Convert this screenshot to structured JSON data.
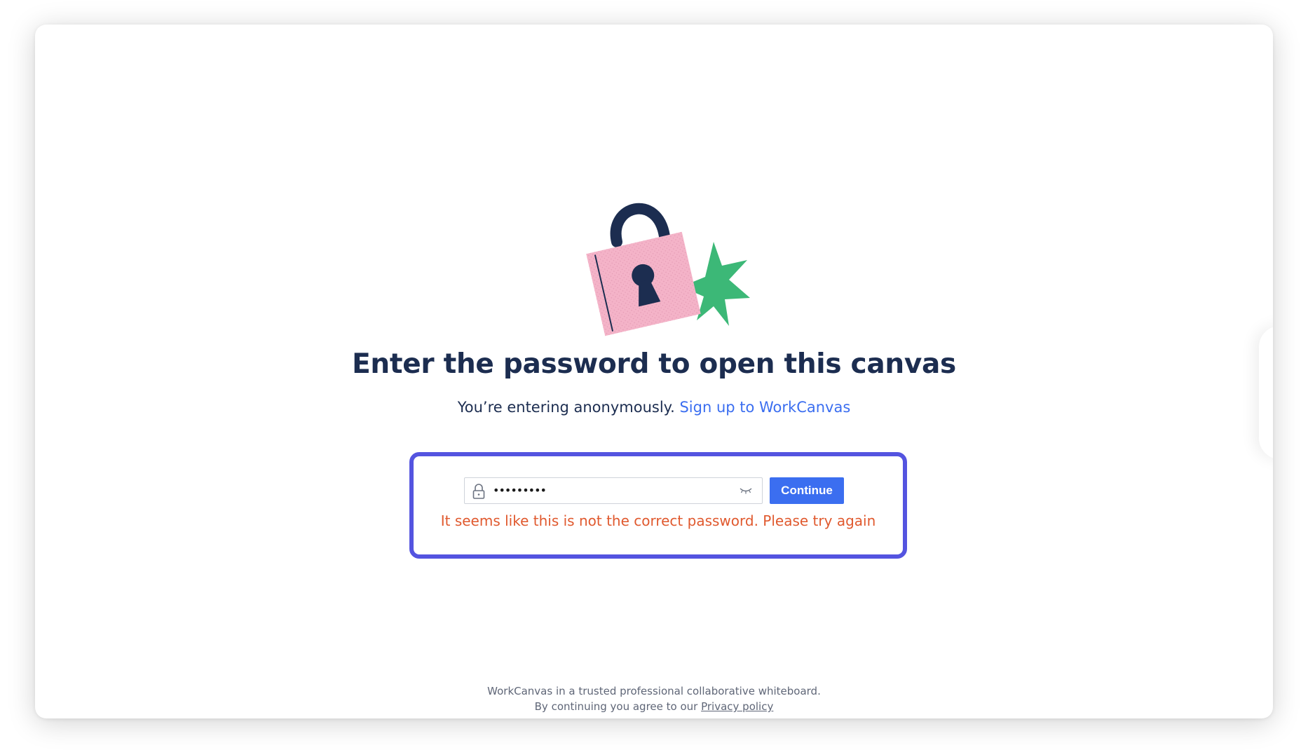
{
  "main": {
    "title": "Enter the password to open this canvas",
    "subtitle_text": "You’re entering anonymously.",
    "signup_link": "Sign up to WorkCanvas"
  },
  "form": {
    "password_value": "•••••••••",
    "continue_label": "Continue",
    "error_message": "It seems like this is not the correct password. Please try again",
    "accent_color": "#5454e0",
    "button_color": "#3b6ef0",
    "error_color": "#e0592e"
  },
  "footer": {
    "line1": "WorkCanvas in a trusted professional collaborative whiteboard.",
    "line2_prefix": "By continuing you agree to our",
    "privacy_link": "Privacy policy"
  },
  "icons": {
    "illustration": "padlock-illustration",
    "field_icon": "lock-icon",
    "toggle_icon": "eye-closed-icon"
  }
}
